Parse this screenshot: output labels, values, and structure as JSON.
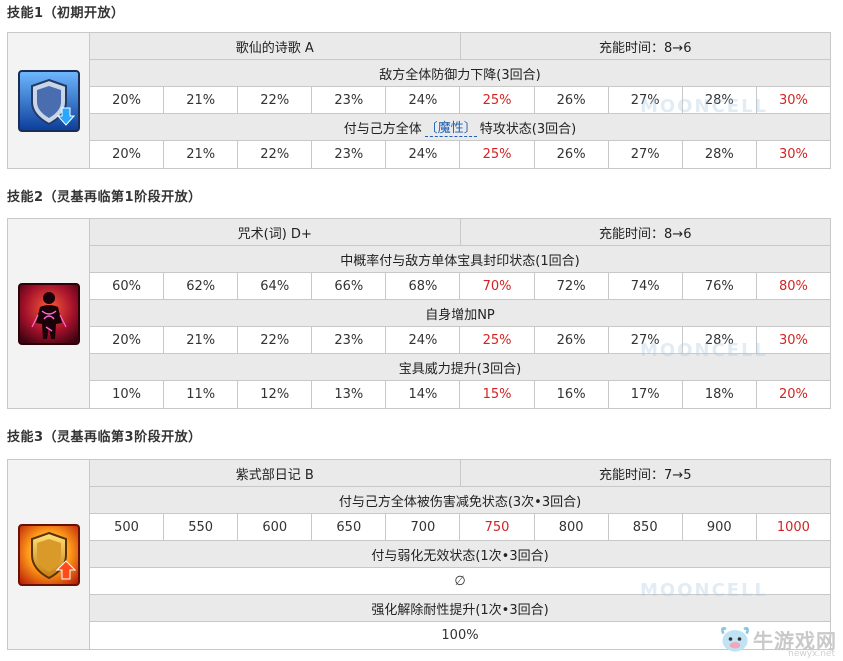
{
  "skills": [
    {
      "title": "技能1（初期开放）",
      "name": "歌仙的诗歌 A",
      "charge": "充能时间：8→6",
      "icon": "shield-defense-down-icon",
      "effects": [
        {
          "label_parts": [
            "敌方全体防御力下降(3回合)"
          ],
          "values": [
            "20%",
            "21%",
            "22%",
            "23%",
            "24%",
            "25%",
            "26%",
            "27%",
            "28%",
            "30%"
          ]
        },
        {
          "label_parts": [
            "付与己方全体",
            "〔魔性〕",
            "特攻状态(3回合)"
          ],
          "values": [
            "20%",
            "21%",
            "22%",
            "23%",
            "24%",
            "25%",
            "26%",
            "27%",
            "28%",
            "30%"
          ]
        }
      ]
    },
    {
      "title": "技能2（灵基再临第1阶段开放）",
      "name": "咒术(词) D+",
      "charge": "充能时间：8→6",
      "icon": "curse-figure-icon",
      "effects": [
        {
          "label_parts": [
            "中概率付与敌方单体宝具封印状态(1回合)"
          ],
          "values": [
            "60%",
            "62%",
            "64%",
            "66%",
            "68%",
            "70%",
            "72%",
            "74%",
            "76%",
            "80%"
          ]
        },
        {
          "label_parts": [
            "自身增加NP"
          ],
          "values": [
            "20%",
            "21%",
            "22%",
            "23%",
            "24%",
            "25%",
            "26%",
            "27%",
            "28%",
            "30%"
          ]
        },
        {
          "label_parts": [
            "宝具威力提升(3回合)"
          ],
          "values": [
            "10%",
            "11%",
            "12%",
            "13%",
            "14%",
            "15%",
            "16%",
            "17%",
            "18%",
            "20%"
          ]
        }
      ]
    },
    {
      "title": "技能3（灵基再临第3阶段开放）",
      "name": "紫式部日记 B",
      "charge": "充能时间：7→5",
      "icon": "shield-damage-cut-icon",
      "effects": [
        {
          "label_parts": [
            "付与己方全体被伤害减免状态(3次•3回合)"
          ],
          "values": [
            "500",
            "550",
            "600",
            "650",
            "700",
            "750",
            "800",
            "850",
            "900",
            "1000"
          ]
        },
        {
          "label_parts": [
            "付与弱化无效状态(1次•3回合)"
          ],
          "single": "∅"
        },
        {
          "label_parts": [
            "强化解除耐性提升(1次•3回合)"
          ],
          "single": "100%"
        }
      ]
    }
  ],
  "watermark_text": "MOONCELL",
  "logo": {
    "brand": "牛游戏网",
    "url": "newyx.net"
  },
  "colors": {
    "highlight": "#d62222",
    "trait": "#1e5fb4",
    "header_bg": "#eaeaea",
    "border": "#c8c8c8"
  }
}
